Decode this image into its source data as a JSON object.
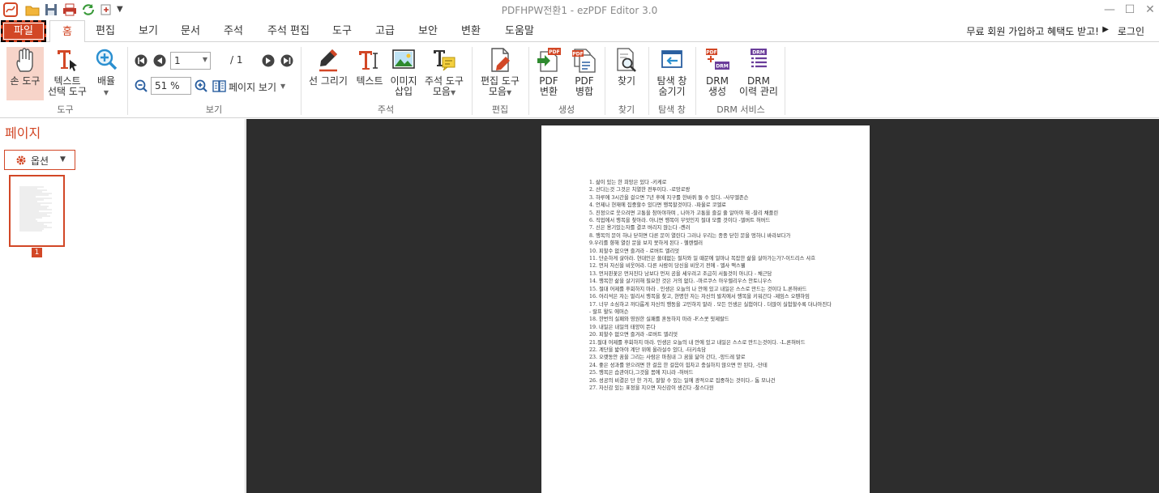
{
  "window": {
    "title": "PDFHPW전환1 - ezPDF Editor 3.0",
    "minimize": "—",
    "maximize": "☐",
    "close": "✕"
  },
  "tabs": [
    "파일",
    "홈",
    "편집",
    "보기",
    "문서",
    "주석",
    "주석 편집",
    "도구",
    "고급",
    "보안",
    "변환",
    "도움말"
  ],
  "promo": "무료 회원 가입하고 혜택도 받고!",
  "login": "로그인",
  "ribbon": {
    "tools": {
      "hand": "손 도구",
      "text_select_1": "텍스트",
      "text_select_2": "선택 도구",
      "zoom": "배율",
      "group": "도구"
    },
    "view": {
      "page_value": "1",
      "page_total": "/ 1",
      "zoom_value": "51 %",
      "page_view": "페이지 보기",
      "group": "보기"
    },
    "annot": {
      "draw": "선 그리기",
      "text": "텍스트",
      "image_1": "이미지",
      "image_2": "삽입",
      "toolset_1": "주석 도구",
      "toolset_2": "모음",
      "group": "주석"
    },
    "edit": {
      "tools_1": "편집 도구",
      "tools_2": "모음",
      "group": "편집"
    },
    "create": {
      "convert_1": "PDF",
      "convert_2": "변환",
      "merge_1": "PDF",
      "merge_2": "병합",
      "group": "생성"
    },
    "find": {
      "find": "찾기",
      "group": "찾기"
    },
    "nav": {
      "hide_1": "탐색 창",
      "hide_2": "숨기기",
      "group": "탐색 창"
    },
    "drm": {
      "create_1": "DRM",
      "create_2": "생성",
      "history_1": "DRM",
      "history_2": "이력 관리",
      "group": "DRM 서비스"
    }
  },
  "icon_text": {
    "pdf": "PDF",
    "drm": "DRM"
  },
  "left_panel": {
    "title": "페이지",
    "options": "옵션",
    "page_number": "1"
  },
  "document": {
    "lines": [
      "1. 삶이 있는 한 희망은 있다 -키케로",
      "2. 산다는것 그것은 치열한 전투이다. -로망로랑",
      "3. 하루에 3시간을 걸으면 7년 후에 지구를 한바퀴 돌 수 있다. -사무엘존슨",
      "4. 언제나 현재에 집중할수 있다면 행복할것이다. -파울로 코엘료",
      "5. 진정으로 웃으려면 고통을 참아야하며 , 나아가 고통을 즐길 줄 알아야 해 -찰리 채플린",
      "6. 직업에서 행복을 찾아라. 아니면 행복이 무엇인지 절대 모를 것이다 -엘버트 허버드",
      "7. 신은 용기있는자를 결코 버리지 않는다 -켄러",
      "8. 행복의 문이 하나 닫히면 다른 문이 열린다 그러나 우리는 종종 닫힌 문을 멍하니 바라보다가",
      "9.우리를 향해 열린 문을 보지 못하게 된다 - 헬렌켈러",
      "10. 피할수 없으면 즐겨라 - 로버트 엘리엇",
      "11. 단순하게 살아라. 현대인은 쓸데없는 절차와 일 때문에 얼마나 복잡한 삶을 살아가는가?-이드리스 샤흐",
      "12. 먼저 자신을 비웃어라. 다른 사람이 당신을 비웃기 전에 - 엘사 맥스웰",
      "13. 먼저핀꽃은 먼저진다 남보다 먼저 공을 세우려고 조급히 서둘것이 아니다 - 채근담",
      "14. 행복한 삶을 살기위해 필요한 것은 거의 없다. -마르쿠스 아우렐리우스 안토니우스",
      "15. 절대 어제를 후회하지 마라 . 인생은 오늘의 나 안에 있고 내일은 스스로 만드는 것이다 L.론허바드",
      "16. 어리석은 자는 멀리서 행복을 찾고, 현명한 자는 자신의 발치에서 행복을 키워간다 -제임스 오펜하임",
      "17. 너무 소심하고 까다롭게 자신의 행동을 고민하지 말라 . 모든 인생은 실험이다 . 더많이 실험할수록 더나아진다 - 랄프 왈도 에머슨",
      "18. 한번의 실패와 영원한 실패를 혼동하지 마라 -F.스콧 핏제랄드",
      "19. 내일은 내일의 태양이 뜬다",
      "20. 피할수 없으면 즐겨라 -로버트 엘리엇",
      "21.절대 어제를 후회하지 마라. 인생은 오늘의 내 안에 있고 내일은 스스로 만드는것이다. -L.론허버드",
      "22. 계단을 밟아야 계단 위에 올라설수 있다, -터키속담",
      "23. 오랫동안 꿈을 그리는 사람은 마침내 그 꿈을 닮아 간다, -앙드레 말로",
      "24. 좋은 성과를 얻으려면 한 걸음 한 걸음이 힘차고 충실하지 않으면 안 된다, -단테",
      "25. 행복은 습관이다,그것을 몸에 지니라 -허버드",
      "26. 성공의 비결은 단 한 가지, 잘할 수 있는 일에 광적으로 집중하는 것이다.- 톰 모나건",
      "27. 자신감 있는 표정을 지으면 자신감이 생긴다 -찰스다윈"
    ]
  },
  "colors": {
    "accent": "#d24726",
    "canvas": "#2d2d2d",
    "page": "#ffffff"
  }
}
